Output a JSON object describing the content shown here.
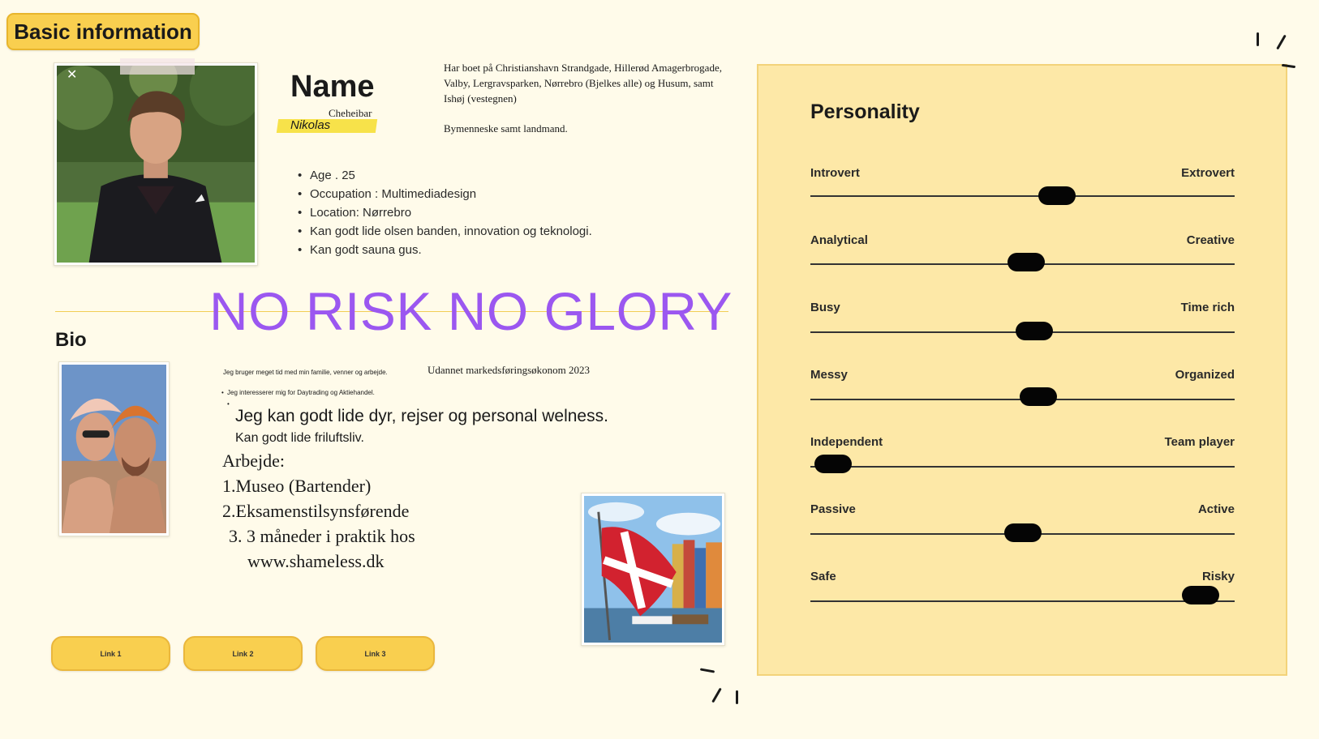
{
  "header": {
    "badge": "Basic information"
  },
  "profile": {
    "name_title": "Name",
    "name_sub": "Cheheibar",
    "first_name": "Nikolas",
    "residence": "Har boet på Christianshavn Strandgade, Hillerød Amagerbrogade, Valby, Lergravsparken, Nørrebro (Bjelkes alle) og Husum, samt Ishøj (vestegnen)",
    "residence_2": "Bymenneske samt landmand.",
    "facts": [
      "Age .  25",
      "Occupation : Multimediadesign",
      "Location: Nørrebro",
      "Kan godt lide olsen banden, innovation og teknologi.",
      "Kan godt sauna gus."
    ]
  },
  "motto": "NO RISK NO GLORY",
  "bio": {
    "heading": "Bio",
    "small_1": "Jeg bruger meget tid med min familie, venner og arbejde.",
    "small_2": "Jeg interesserer mig for Daytrading og Aktiehandel.",
    "education": "Udannet markedsføringsøkonom 2023",
    "large": "Jeg kan godt lide dyr, rejser og personal welness.",
    "mid": "Kan godt lide friluftsliv.",
    "work_heading": "Arbejde:",
    "work_1": "1.Museo (Bartender)",
    "work_2": "2.Eksamenstilsynsførende",
    "work_3": "3.  3 måneder i praktik hos",
    "work_3b": "www.shameless.dk"
  },
  "links": [
    "Link 1",
    "Link 2",
    "Link 3"
  ],
  "personality": {
    "title": "Personality",
    "traits": [
      {
        "left": "Introvert",
        "right": "Extrovert",
        "value": 0.59
      },
      {
        "left": "Analytical",
        "right": "Creative",
        "value": 0.51
      },
      {
        "left": "Busy",
        "right": "Time rich",
        "value": 0.53
      },
      {
        "left": "Messy",
        "right": "Organized",
        "value": 0.54
      },
      {
        "left": "Independent",
        "right": "Team player",
        "value": 0.01
      },
      {
        "left": "Passive",
        "right": "Active",
        "value": 0.5
      },
      {
        "left": "Safe",
        "right": "Risky",
        "value": 0.96
      }
    ]
  },
  "colors": {
    "background": "#fffbea",
    "accent_yellow": "#f9cf4f",
    "panel": "#fde8a7",
    "motto_purple": "#9b57f0",
    "knob": "#050505"
  }
}
